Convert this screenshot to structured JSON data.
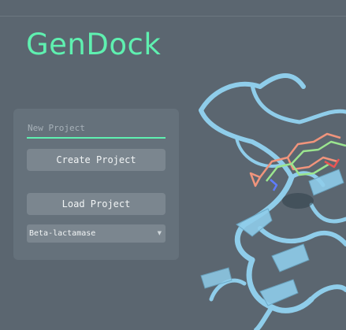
{
  "app": {
    "title": "GenDock"
  },
  "project_panel": {
    "new_project_placeholder": "New Project",
    "create_label": "Create Project",
    "load_label": "Load Project",
    "target_select": {
      "value": "Beta-lactamase"
    }
  },
  "icons": {
    "dropdown": "chevron-down-icon"
  },
  "colors": {
    "background": "#5b6670",
    "panel": "#65717b",
    "button": "#7b868f",
    "accent": "#5ff0b0",
    "protein": "#8fcdea"
  }
}
